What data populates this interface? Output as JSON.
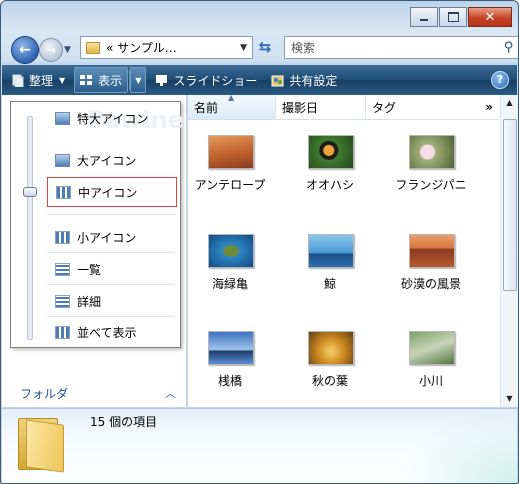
{
  "window": {
    "controls": [
      "minimize",
      "maximize",
      "close"
    ]
  },
  "navigation": {
    "address_text": "« サンプル…",
    "search_placeholder": "検索"
  },
  "toolbar": {
    "organize_label": "整理",
    "views_label": "表示",
    "slideshow_label": "スライドショー",
    "share_label": "共有設定",
    "help_label": "?"
  },
  "view_menu": {
    "watermark": "Pawine",
    "items": [
      {
        "label": "特大アイコン",
        "icon": "extra-large-icons-icon"
      },
      {
        "label": "大アイコン",
        "icon": "large-icons-icon"
      },
      {
        "label": "中アイコン",
        "icon": "medium-icons-icon",
        "selected": true
      },
      {
        "label": "小アイコン",
        "icon": "small-icons-icon"
      },
      {
        "label": "一覧",
        "icon": "list-icon"
      },
      {
        "label": "詳細",
        "icon": "details-icon"
      },
      {
        "label": "並べて表示",
        "icon": "tiles-icon"
      }
    ]
  },
  "folders_pane": {
    "label": "フォルダ"
  },
  "columns": [
    {
      "label": "名前",
      "sorted": true
    },
    {
      "label": "撮影日"
    },
    {
      "label": "タグ"
    }
  ],
  "columns_more": "»",
  "files": [
    {
      "name": "アンテロープ",
      "colors": [
        "#c96b3a",
        "#f1b27a"
      ]
    },
    {
      "name": "オオハシ",
      "colors": [
        "#2e5b2c",
        "#6e9b3a"
      ]
    },
    {
      "name": "フランジパニ",
      "colors": [
        "#c7a8b8",
        "#5a6b3d"
      ]
    },
    {
      "name": "海緑亀",
      "colors": [
        "#1f6db0",
        "#57b2c9"
      ]
    },
    {
      "name": "鯨",
      "colors": [
        "#4b9fd6",
        "#1d4f86"
      ]
    },
    {
      "name": "砂漠の風景",
      "colors": [
        "#e38a4b",
        "#8b3a24"
      ]
    },
    {
      "name": "桟橋",
      "colors": [
        "#5b8ed1",
        "#d7e7f7"
      ]
    },
    {
      "name": "秋の葉",
      "colors": [
        "#f3b64a",
        "#7a5a1e"
      ]
    },
    {
      "name": "小川",
      "colors": [
        "#5f8a4e",
        "#b8c7a8"
      ]
    }
  ],
  "status": {
    "item_count_text": "15 個の項目"
  }
}
